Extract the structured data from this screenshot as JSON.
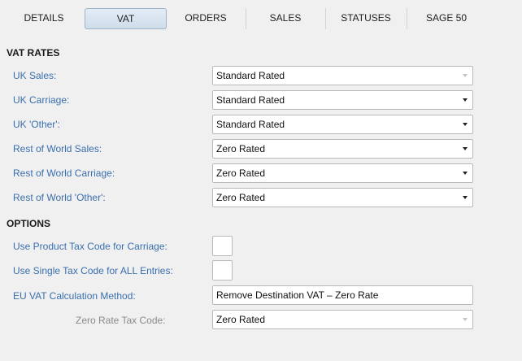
{
  "tabs": [
    {
      "label": "DETAILS"
    },
    {
      "label": "VAT"
    },
    {
      "label": "ORDERS"
    },
    {
      "label": "SALES"
    },
    {
      "label": "STATUSES"
    },
    {
      "label": "SAGE 50"
    }
  ],
  "active_tab": "VAT",
  "vat_rates": {
    "title": "VAT RATES",
    "rows": [
      {
        "label": "UK Sales:",
        "value": "Standard Rated",
        "enabled": false
      },
      {
        "label": "UK Carriage:",
        "value": "Standard Rated",
        "enabled": true
      },
      {
        "label": "UK 'Other':",
        "value": "Standard Rated",
        "enabled": true
      },
      {
        "label": "Rest of World Sales:",
        "value": "Zero Rated",
        "enabled": true
      },
      {
        "label": "Rest of World Carriage:",
        "value": "Zero Rated",
        "enabled": true
      },
      {
        "label": "Rest of World 'Other':",
        "value": "Zero Rated",
        "enabled": true
      }
    ]
  },
  "options": {
    "title": "OPTIONS",
    "use_product_tax_code": {
      "label": "Use Product Tax Code for Carriage:",
      "checked": false
    },
    "use_single_tax_code": {
      "label": "Use Single Tax Code for ALL Entries:",
      "checked": false
    },
    "eu_vat_method": {
      "label": "EU VAT Calculation Method:",
      "value": "Remove Destination VAT – Zero Rate"
    },
    "zero_rate_tax_code": {
      "label": "Zero Rate Tax Code:",
      "value": "Zero Rated",
      "enabled": false
    }
  },
  "colors": {
    "label_blue": "#3a6fae",
    "background": "#f0f0f0",
    "active_tab_fill": "#d6e2ef"
  }
}
